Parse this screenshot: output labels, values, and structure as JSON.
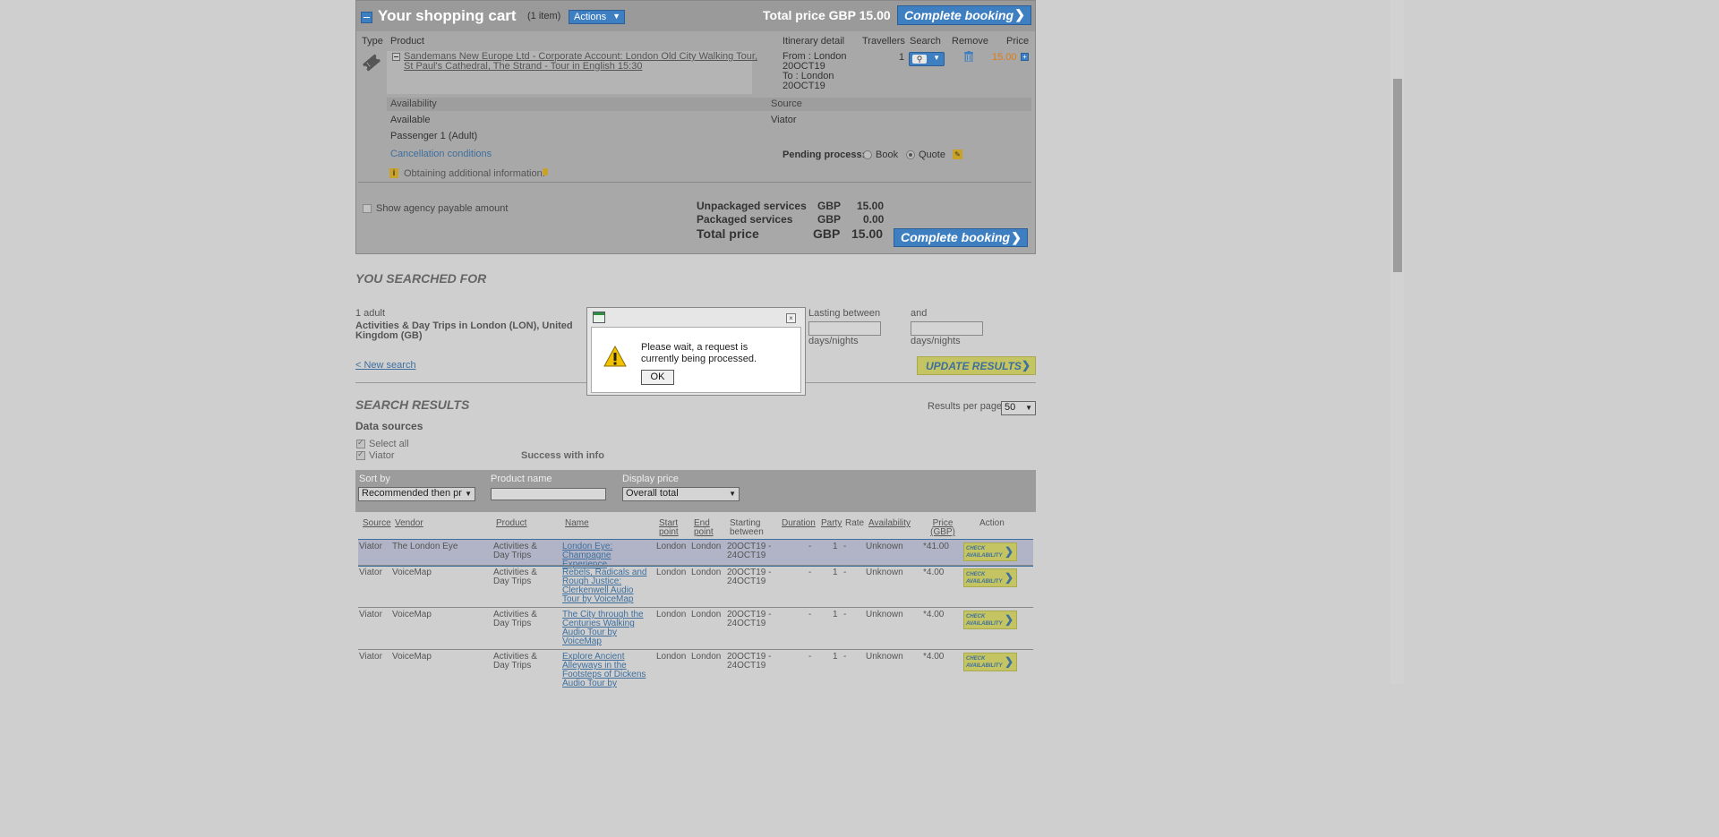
{
  "cart": {
    "title": "Your shopping cart",
    "item_count": "(1 item)",
    "actions_label": "Actions",
    "total_price_label": "Total price GBP 15.00",
    "complete_booking_label": "Complete booking",
    "columns": {
      "type": "Type",
      "product": "Product",
      "itinerary": "Itinerary detail",
      "travellers": "Travellers",
      "search": "Search",
      "remove": "Remove",
      "price": "Price"
    },
    "item": {
      "product": "Sandemans New Europe Ltd - Corporate Account: London Old City Walking Tour, St Paul's Cathedral, The Strand - Tour in English 15:30",
      "itinerary_from": "From : London 20OCT19",
      "itinerary_to": "To : London 20OCT19",
      "travellers": "1",
      "price": "15.00",
      "availability_header": "Availability",
      "source_header": "Source",
      "availability": "Available",
      "source": "Viator",
      "passenger": "Passenger 1 (Adult)",
      "cancellation": "Cancellation conditions",
      "pending_label": "Pending process:",
      "book_label": "Book",
      "quote_label": "Quote",
      "obtaining_info": "Obtaining additional information."
    },
    "show_agency_label": "Show agency payable amount",
    "summary": {
      "unpackaged_label": "Unpackaged services",
      "unpackaged_cur": "GBP",
      "unpackaged_val": "15.00",
      "packaged_label": "Packaged services",
      "packaged_cur": "GBP",
      "packaged_val": "0.00",
      "total_label": "Total price",
      "total_cur": "GBP",
      "total_val": "15.00"
    }
  },
  "searched": {
    "title": "YOU SEARCHED FOR",
    "adults": "1 adult",
    "destination": "Activities & Day Trips in London (LON), United Kingdom (GB)",
    "lasting_label": "Lasting between",
    "and_label": "and",
    "unit1": "days/nights",
    "unit2": "days/nights",
    "new_search": "< New search",
    "update_results": "UPDATE RESULTS"
  },
  "results": {
    "title": "SEARCH RESULTS",
    "per_page_label": "Results per page",
    "per_page_value": "50",
    "data_sources_label": "Data sources",
    "select_all": "Select all",
    "viator": "Viator",
    "status": "Success with info",
    "filters": {
      "sort_by_label": "Sort by",
      "sort_by_value": "Recommended then pr",
      "product_name_label": "Product name",
      "display_price_label": "Display price",
      "display_price_value": "Overall total"
    },
    "headers": {
      "source": "Source",
      "vendor": "Vendor",
      "product": "Product",
      "name": "Name",
      "start": "Start point",
      "end": "End point",
      "starting": "Starting between",
      "duration": "Duration",
      "party": "Party",
      "rate": "Rate",
      "availability": "Availability",
      "price": "Price (GBP)",
      "action": "Action"
    },
    "rows": [
      {
        "source": "Viator",
        "vendor": "The London Eye",
        "product": "Activities & Day Trips",
        "name": "London Eye: Champagne Experience",
        "start": "London",
        "end": "London",
        "starting": "20OCT19 - 24OCT19",
        "duration": "-",
        "party": "1",
        "rate": "-",
        "availability": "Unknown",
        "price": "*41.00",
        "action": "CHECK AVAILABILITY"
      },
      {
        "source": "Viator",
        "vendor": "VoiceMap",
        "product": "Activities & Day Trips",
        "name": "Rebels, Radicals and Rough Justice: Clerkenwell Audio Tour by VoiceMap",
        "start": "London",
        "end": "London",
        "starting": "20OCT19 - 24OCT19",
        "duration": "-",
        "party": "1",
        "rate": "-",
        "availability": "Unknown",
        "price": "*4.00",
        "action": "CHECK AVAILABILITY"
      },
      {
        "source": "Viator",
        "vendor": "VoiceMap",
        "product": "Activities & Day Trips",
        "name": "The City through the Centuries Walking Audio Tour by VoiceMap",
        "start": "London",
        "end": "London",
        "starting": "20OCT19 - 24OCT19",
        "duration": "-",
        "party": "1",
        "rate": "-",
        "availability": "Unknown",
        "price": "*4.00",
        "action": "CHECK AVAILABILITY"
      },
      {
        "source": "Viator",
        "vendor": "VoiceMap",
        "product": "Activities & Day Trips",
        "name": "Explore Ancient Alleyways in the Footsteps of Dickens Audio Tour by",
        "start": "London",
        "end": "London",
        "starting": "20OCT19 - 24OCT19",
        "duration": "-",
        "party": "1",
        "rate": "-",
        "availability": "Unknown",
        "price": "*4.00",
        "action": "CHECK AVAILABILITY"
      }
    ]
  },
  "dialog": {
    "message": "Please wait, a request is currently being processed.",
    "ok_label": "OK"
  },
  "icons": {
    "collapse": "minus-icon",
    "ticket": "ticket-icon",
    "search": "magnifier-icon",
    "remove": "trash-icon",
    "warning": "warning-icon",
    "info": "info-icon"
  },
  "colors": {
    "accent_blue": "#3e7fc2",
    "price_orange": "#e07b12",
    "update_yellow": "#c4c463",
    "overlay_bg": "#cfcfcf"
  }
}
